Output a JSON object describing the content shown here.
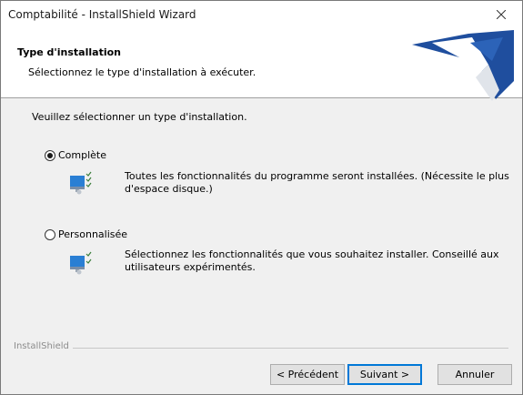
{
  "window": {
    "title": "Comptabilité - InstallShield Wizard"
  },
  "header": {
    "title": "Type d'installation",
    "subtitle": "Sélectionnez le type d'installation à exécuter."
  },
  "body": {
    "prompt": "Veuillez sélectionner un type d'installation.",
    "options": [
      {
        "label": "Complète",
        "selected": true,
        "icon": "install-complete-icon",
        "description": "Toutes les fonctionnalités du programme seront installées. (Nécessite le plus d'espace disque.)"
      },
      {
        "label": "Personnalisée",
        "selected": false,
        "icon": "install-custom-icon",
        "description": "Sélectionnez les fonctionnalités que vous souhaitez installer. Conseillé aux utilisateurs expérimentés."
      }
    ]
  },
  "footer": {
    "brand": "InstallShield",
    "buttons": {
      "back": "< Précédent",
      "next": "Suivant >",
      "cancel": "Annuler"
    }
  },
  "colors": {
    "logo_blue": "#1f4e9e",
    "focus_blue": "#0078d7",
    "dialog_bg": "#f0f0f0"
  }
}
